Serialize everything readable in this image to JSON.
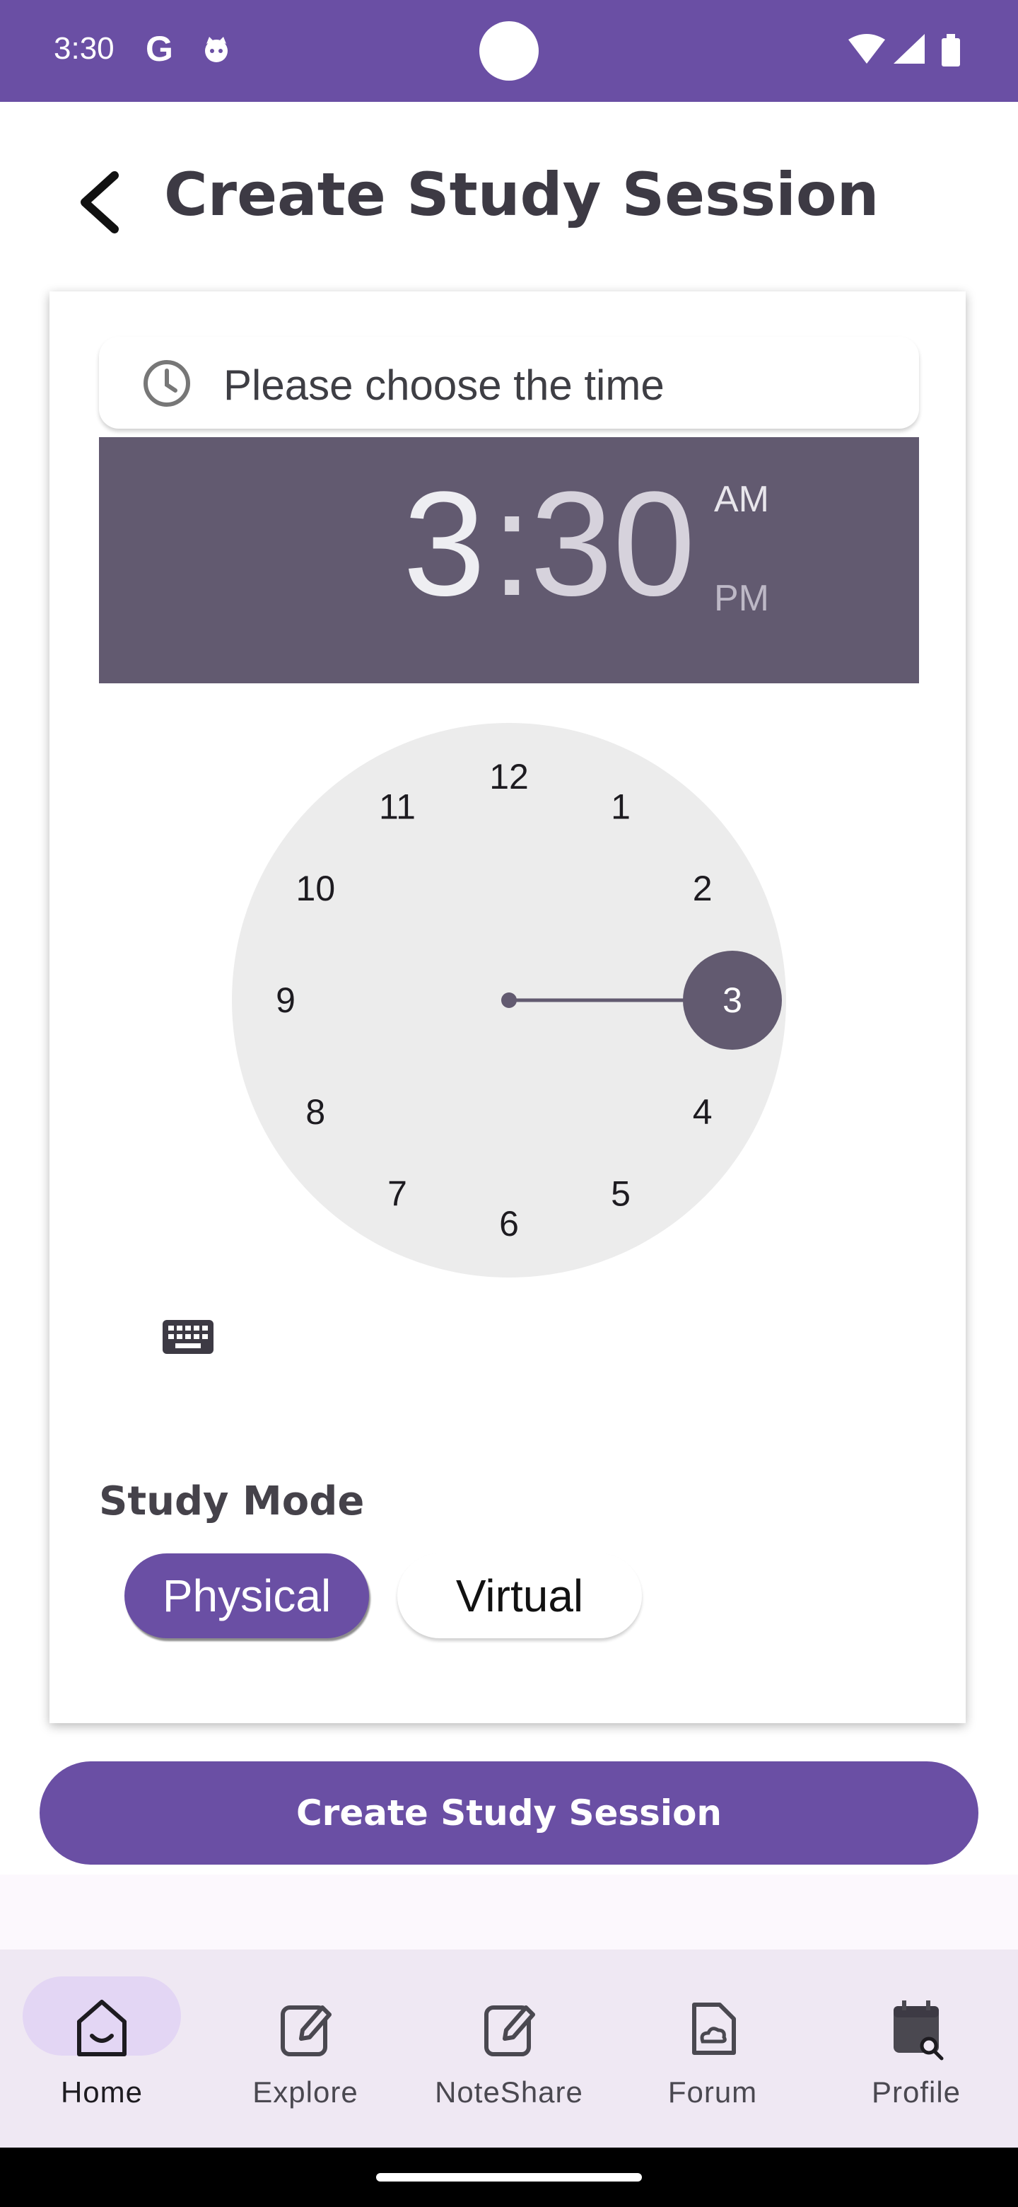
{
  "status_bar": {
    "time": "3:30",
    "g_label": "G",
    "icons": [
      "google-icon",
      "cat-icon",
      "wifi-icon",
      "signal-icon",
      "battery-icon"
    ]
  },
  "header": {
    "title": "Create Study Session",
    "back_icon": "chevron-left-icon"
  },
  "time_field": {
    "placeholder": "Please choose the time",
    "icon": "clock-icon"
  },
  "time_picker": {
    "hour": "3",
    "separator": ":",
    "minute": "30",
    "am_label": "AM",
    "pm_label": "PM",
    "selected_period": "PM",
    "selected_hour": 3,
    "dial_numbers": [
      "12",
      "1",
      "2",
      "3",
      "4",
      "5",
      "6",
      "7",
      "8",
      "9",
      "10",
      "11"
    ],
    "keyboard_icon": "keyboard-icon",
    "colors": {
      "header_bg": "#625a70",
      "dial_bg": "#ececec",
      "hand": "#625a70"
    }
  },
  "study_mode": {
    "label": "Study Mode",
    "options": [
      "Physical",
      "Virtual"
    ],
    "selected": "Physical"
  },
  "primary_action": {
    "label": "Create Study Session"
  },
  "bottom_nav": {
    "items": [
      {
        "label": "Home",
        "icon": "home-icon",
        "active": true
      },
      {
        "label": "Explore",
        "icon": "edit-icon",
        "active": false
      },
      {
        "label": "NoteShare",
        "icon": "edit-icon",
        "active": false
      },
      {
        "label": "Forum",
        "icon": "cloud-note-icon",
        "active": false
      },
      {
        "label": "Profile",
        "icon": "calendar-search-icon",
        "active": false
      }
    ]
  },
  "colors": {
    "brand": "#6a4fa4",
    "nav_bg": "#efe8f3",
    "nav_active_pill": "#e3d6f4"
  }
}
